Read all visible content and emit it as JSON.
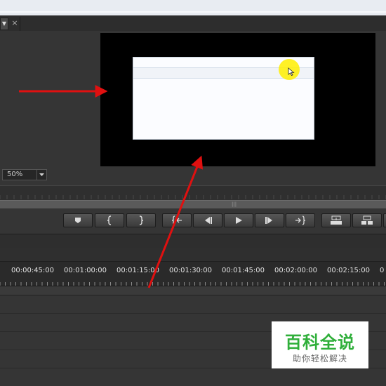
{
  "tab": {
    "menu_icon": "dropdown-triangle-icon",
    "close_label": "×"
  },
  "monitor": {
    "zoom_value": "50%"
  },
  "timeline": {
    "timecodes": [
      "00:00:45:00",
      "00:01:00:00",
      "00:01:15:00",
      "00:01:30:00",
      "00:01:45:00",
      "00:02:00:00",
      "00:02:15:00",
      "0"
    ]
  },
  "transport": {
    "buttons": [
      {
        "name": "add-marker-button",
        "icon": "marker-icon"
      },
      {
        "name": "mark-in-button",
        "icon": "mark-in-icon"
      },
      {
        "name": "mark-out-button",
        "icon": "mark-out-icon"
      },
      {
        "name": "go-to-in-button",
        "icon": "go-to-in-icon"
      },
      {
        "name": "step-back-button",
        "icon": "step-back-icon"
      },
      {
        "name": "play-button",
        "icon": "play-icon"
      },
      {
        "name": "step-forward-button",
        "icon": "step-forward-icon"
      },
      {
        "name": "go-to-out-button",
        "icon": "go-to-out-icon"
      },
      {
        "name": "lift-button",
        "icon": "lift-icon"
      },
      {
        "name": "extract-button",
        "icon": "extract-icon"
      }
    ]
  },
  "watermark": {
    "main": "百科全说",
    "sub": "助你轻松解决"
  },
  "colors": {
    "annotation_arrow": "#e01010",
    "highlight": "#ffee00",
    "watermark_green": "#2faf3a"
  }
}
